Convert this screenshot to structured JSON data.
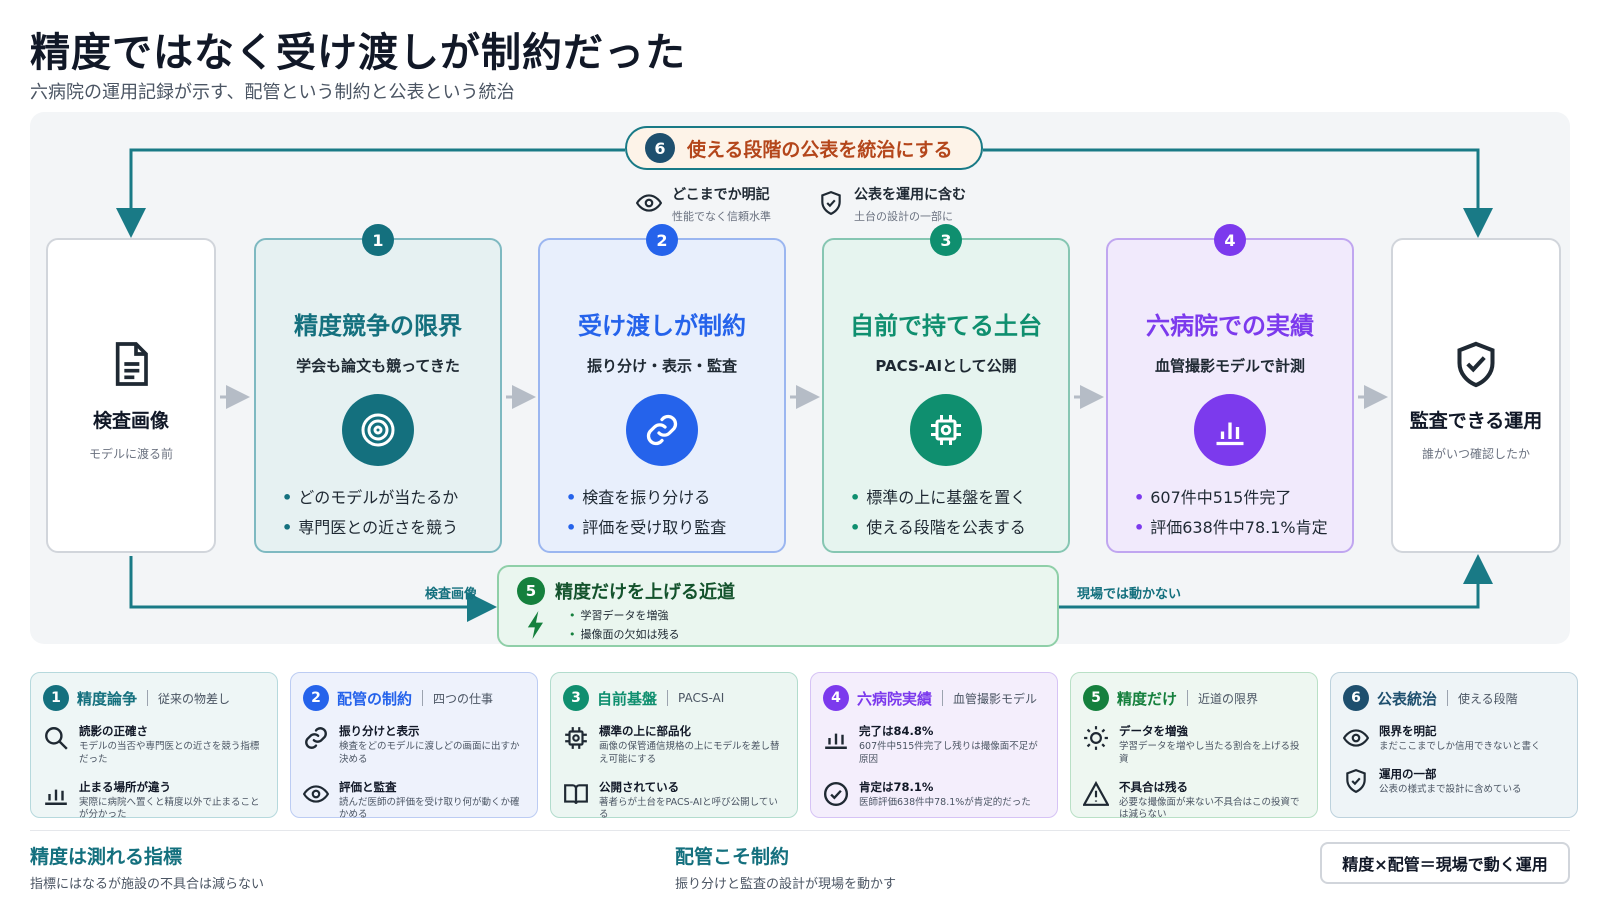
{
  "header": {
    "title": "精度ではなく受け渡しが制約だった",
    "subtitle": "六病院の運用記録が示す、配管という制約と公表という統治"
  },
  "banner": {
    "num": "6",
    "text": "使える段階の公表を統治にする"
  },
  "notes": [
    {
      "title": "どこまでか明記",
      "sub": "性能でなく信頼水準",
      "icon": "eye-icon"
    },
    {
      "title": "公表を運用に含む",
      "sub": "土台の設計の一部に",
      "icon": "shield-check-icon"
    }
  ],
  "left_card": {
    "label": "検査画像",
    "sub": "モデルに渡る前",
    "icon": "document-icon"
  },
  "right_card": {
    "label": "監査できる運用",
    "sub": "誰がいつ確認したか",
    "icon": "shield-check-icon"
  },
  "stages": [
    {
      "num": "1",
      "title": "精度競争の限界",
      "sub": "学会も論文も競ってきた",
      "icon": "target-icon",
      "bullets": [
        "どのモデルが当たるか",
        "専門医との近さを競う"
      ]
    },
    {
      "num": "2",
      "title": "受け渡しが制約",
      "sub": "振り分け・表示・監査",
      "icon": "link-icon",
      "bullets": [
        "検査を振り分ける",
        "評価を受け取り監査"
      ]
    },
    {
      "num": "3",
      "title": "自前で持てる土台",
      "sub": "PACS-AIとして公開",
      "icon": "chip-icon",
      "bullets": [
        "標準の上に基盤を置く",
        "使える段階を公表する"
      ]
    },
    {
      "num": "4",
      "title": "六病院での実績",
      "sub": "血管撮影モデルで計測",
      "icon": "bar-chart-icon",
      "bullets": [
        "607件中515件完了",
        "評価638件中78.1%肯定"
      ]
    }
  ],
  "shortcut": {
    "num": "5",
    "title": "精度だけを上げる近道",
    "bullets": [
      "学習データを増強",
      "撮像面の欠如は残る"
    ],
    "in_label": "検査画像",
    "out_label": "現場では動かない",
    "icon": "bolt-icon"
  },
  "bottom_cards": [
    {
      "num": "1",
      "key": "精度論争",
      "tag": "従来の物差し",
      "items": [
        {
          "icon": "search-icon",
          "title": "読影の正確さ",
          "desc": "モデルの当否や専門医との近さを競う指標だった"
        },
        {
          "icon": "bar-chart-icon",
          "title": "止まる場所が違う",
          "desc": "実際に病院へ置くと精度以外で止まることが分かった"
        }
      ]
    },
    {
      "num": "2",
      "key": "配管の制約",
      "tag": "四つの仕事",
      "items": [
        {
          "icon": "link-icon",
          "title": "振り分けと表示",
          "desc": "検査をどのモデルに渡しどの画面に出すか決める"
        },
        {
          "icon": "eye-icon",
          "title": "評価と監査",
          "desc": "読んだ医師の評価を受け取り何が動くか確かめる"
        }
      ]
    },
    {
      "num": "3",
      "key": "自前基盤",
      "tag": "PACS-AI",
      "items": [
        {
          "icon": "chip-icon",
          "title": "標準の上に部品化",
          "desc": "画像の保管通信規格の上にモデルを差し替え可能にする"
        },
        {
          "icon": "book-icon",
          "title": "公開されている",
          "desc": "著者らが土台をPACS-AIと呼び公開している"
        }
      ]
    },
    {
      "num": "4",
      "key": "六病院実績",
      "tag": "血管撮影モデル",
      "items": [
        {
          "icon": "bar-chart-icon",
          "title": "完了は84.8%",
          "desc": "607件中515件完了し残りは撮像面不足が原因"
        },
        {
          "icon": "check-circle-icon",
          "title": "肯定は78.1%",
          "desc": "医師評価638件中78.1%が肯定的だった"
        }
      ]
    },
    {
      "num": "5",
      "key": "精度だけ",
      "tag": "近道の限界",
      "items": [
        {
          "icon": "sun-icon",
          "title": "データを増強",
          "desc": "学習データを増やし当たる割合を上げる投資"
        },
        {
          "icon": "warning-icon",
          "title": "不具合は残る",
          "desc": "必要な撮像面が来ない不具合はこの投資では減らない"
        }
      ]
    },
    {
      "num": "6",
      "key": "公表統治",
      "tag": "使える段階",
      "items": [
        {
          "icon": "eye-icon",
          "title": "限界を明記",
          "desc": "まだここまでしか信用できないと書く"
        },
        {
          "icon": "shield-check-icon",
          "title": "運用の一部",
          "desc": "公表の様式まで設計に含めている"
        }
      ]
    }
  ],
  "footer": {
    "left_title": "精度は測れる指標",
    "left_sub": "指標にはなるが施設の不具合は減らない",
    "mid_title": "配管こそ制約",
    "mid_sub": "振り分けと監査の設計が現場を動かす",
    "formula": "精度×配管＝現場で動く運用"
  },
  "colors": {
    "teal": "#14707e",
    "blue": "#2563eb",
    "green": "#0f8f6f",
    "purple": "#7c3aed",
    "dark_green": "#15803d",
    "navy": "#1e4f6e",
    "orange": "#b4461b"
  }
}
